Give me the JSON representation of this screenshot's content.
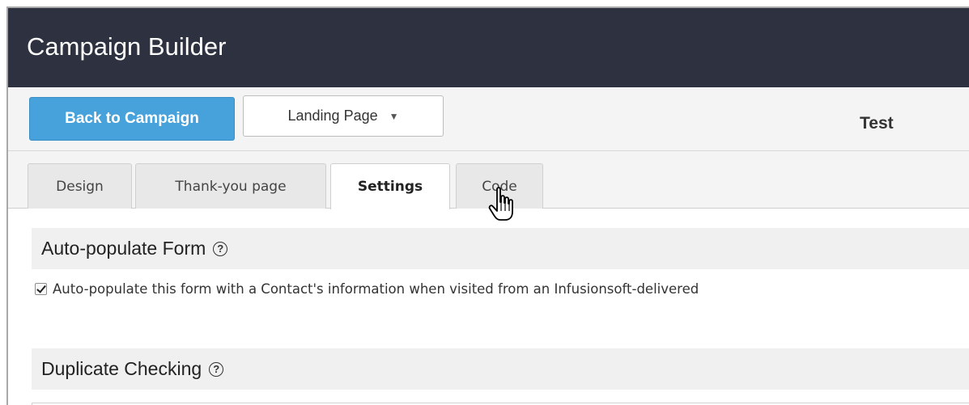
{
  "app": {
    "title": "Campaign Builder"
  },
  "toolbar": {
    "back_label": "Back to Campaign",
    "page_type": "Landing Page",
    "page_name": "Test"
  },
  "tabs": [
    {
      "label": "Design",
      "active": false
    },
    {
      "label": "Thank-you page",
      "active": false
    },
    {
      "label": "Settings",
      "active": true
    },
    {
      "label": "Code",
      "active": false
    }
  ],
  "sections": {
    "autopopulate": {
      "title": "Auto-populate Form",
      "checkbox_label": "Auto-populate this form with a Contact's information when visited from an Infusionsoft-delivered",
      "checked": true
    },
    "duplicate": {
      "title": "Duplicate Checking"
    }
  },
  "icons": {
    "help": "question-circle-icon",
    "dropdown": "caret-down-icon",
    "cursor": "hand-pointer-icon"
  },
  "colors": {
    "titlebar": "#2d3140",
    "primary_button": "#47a1da"
  }
}
